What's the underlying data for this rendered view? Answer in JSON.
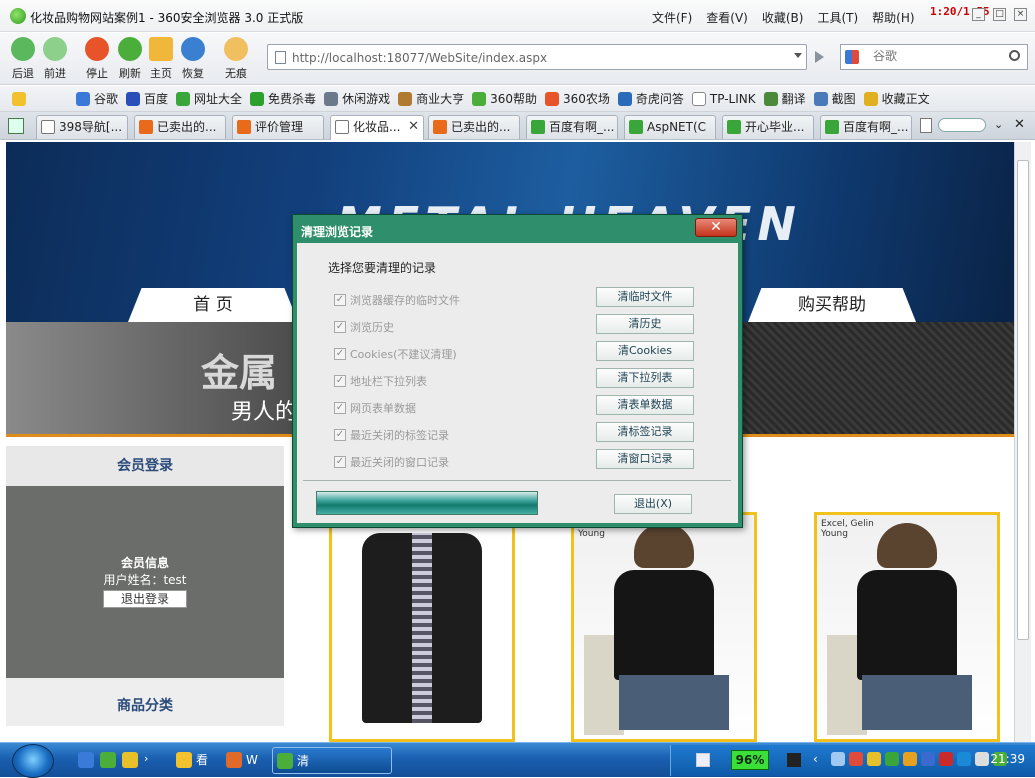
{
  "window": {
    "title": "化妆品购物网站案例1 - 360安全浏览器 3.0 正式版",
    "menu": [
      "文件(F)",
      "查看(V)",
      "收藏(B)",
      "工具(T)",
      "帮助(H)"
    ],
    "timer": "1:20/1:55"
  },
  "toolbar": {
    "back": "后退",
    "forward": "前进",
    "stop": "停止",
    "refresh": "刷新",
    "home": "主页",
    "restore": "恢复",
    "incognito": "无痕",
    "address": "http://localhost:18077/WebSite/index.aspx",
    "search_placeholder": "谷歌"
  },
  "favorites": [
    "谷歌",
    "百度",
    "网址大全",
    "免费杀毒",
    "休闲游戏",
    "商业大亨",
    "360帮助",
    "360农场",
    "奇虎问答",
    "TP-LINK",
    "翻译",
    "截图",
    "收藏正文"
  ],
  "tabs": [
    {
      "label": "398导航[...",
      "active": false
    },
    {
      "label": "已卖出的...",
      "active": false
    },
    {
      "label": "评价管理",
      "active": false
    },
    {
      "label": "化妆品...",
      "active": true
    },
    {
      "label": "已卖出的...",
      "active": false
    },
    {
      "label": "百度有啊_...",
      "active": false
    },
    {
      "label": "AspNET(C",
      "active": false
    },
    {
      "label": "开心毕业...",
      "active": false
    },
    {
      "label": "百度有啊_...",
      "active": false
    }
  ],
  "site": {
    "nav_home": "首 页",
    "nav_help": "购买帮助",
    "hero_title": "金属",
    "hero_sub": "男人的",
    "member_login": "会员登录",
    "member_info": "会员信息",
    "username_label": "用户姓名：test",
    "logout": "退出登录",
    "category": "商品分类",
    "magazine_lines": [
      "Excel, Gelin",
      "Young"
    ]
  },
  "dialog": {
    "title": "清理浏览记录",
    "heading": "选择您要清理的记录",
    "options": [
      {
        "label": "浏览器缓存的临时文件",
        "button": "清临时文件"
      },
      {
        "label": "浏览历史",
        "button": "清历史"
      },
      {
        "label": "Cookies(不建议清理)",
        "button": "清Cookies"
      },
      {
        "label": "地址栏下拉列表",
        "button": "清下拉列表"
      },
      {
        "label": "网页表单数据",
        "button": "清表单数据"
      },
      {
        "label": "最近关闭的标签记录",
        "button": "清标签记录"
      },
      {
        "label": "最近关闭的窗口记录",
        "button": "清窗口记录"
      }
    ],
    "exit": "退出(X)"
  },
  "taskbar": {
    "tasks": [
      "看",
      "W",
      "清"
    ],
    "battery": "96%",
    "clock": "21:39"
  }
}
